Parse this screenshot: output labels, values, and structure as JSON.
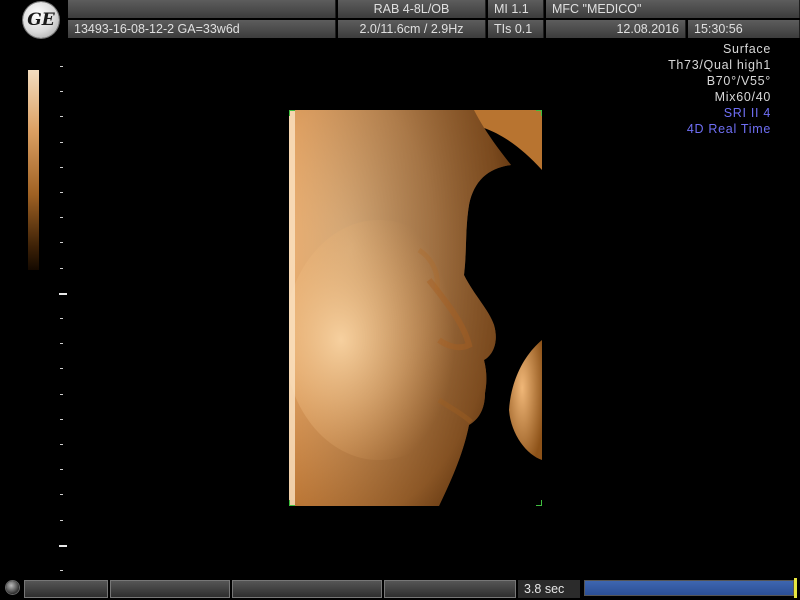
{
  "header": {
    "logo_icon": "ge-logo-icon",
    "probe": "RAB 4-8L/OB",
    "mi": "MI  1.1",
    "institution": "MFC \"MEDICO\"",
    "patient_id": "13493-16-08-12-2  GA=33w6d",
    "depth_freq": "2.0/11.6cm / 2.9Hz",
    "tis": "TIs  0.1",
    "date": "12.08.2016",
    "time": "15:30:56"
  },
  "settings": {
    "line1": "Surface",
    "line2": "Th73/Qual high1",
    "line3": "B70°/V55°",
    "line4": "Mix60/40",
    "line5": "SRI II 4",
    "line6": "4D Real Time",
    "accent_color": "#6f6ff5"
  },
  "status": {
    "cine_time": "3.8 sec",
    "cine_progress": 1.0,
    "cine_color": "#3e66b0"
  },
  "image": {
    "description_icon": "fetal-face-3d-render",
    "tint_color": "#e0a060"
  }
}
